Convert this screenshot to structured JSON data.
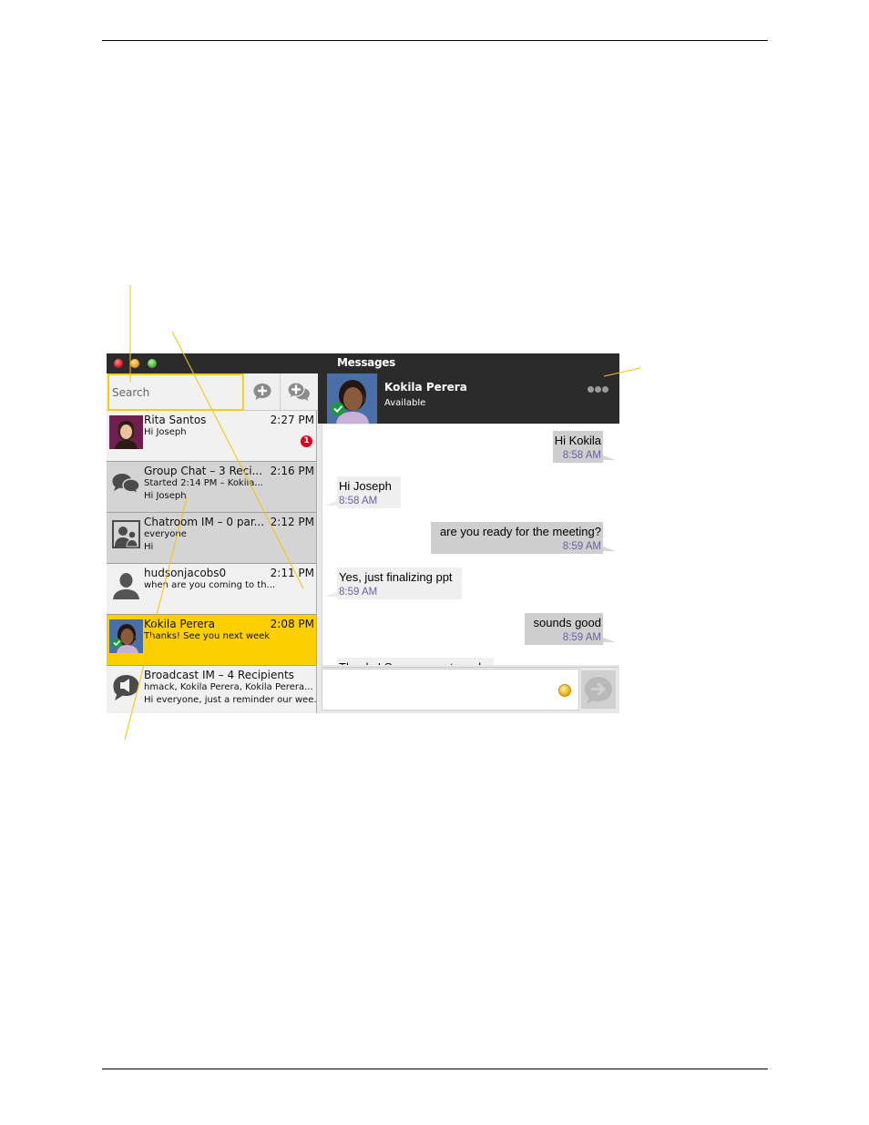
{
  "window": {
    "title": "Messages"
  },
  "search": {
    "placeholder": "Search"
  },
  "toolbar": {
    "new_im_icon": "plus-bubble-icon",
    "new_group_icon": "plus-double-bubble-icon"
  },
  "conversations": [
    {
      "name": "Rita Santos",
      "time": "2:27 PM",
      "line1": "Hi Joseph",
      "line2": "",
      "badge": "1",
      "avatar": "photo",
      "state": "light"
    },
    {
      "name": "Group Chat – 3 Reci...",
      "time": "2:16 PM",
      "line1": "Started 2:14 PM – Kokila...",
      "line2": "Hi Joseph",
      "avatar": "group-chat-icon",
      "state": "dark"
    },
    {
      "name": "Chatroom IM – 0 par...",
      "time": "2:12 PM",
      "line1": "everyone",
      "line2": "Hi",
      "avatar": "chatroom-icon",
      "state": "dark"
    },
    {
      "name": "hudsonjacobs0",
      "time": "2:11 PM",
      "line1": "when are you coming to th...",
      "line2": "",
      "avatar": "person-icon",
      "state": "light"
    },
    {
      "name": "Kokila Perera",
      "time": "2:08 PM",
      "line1": "Thanks! See you next week",
      "line2": "",
      "avatar": "photo",
      "presence": "available",
      "state": "selected"
    },
    {
      "name": "Broadcast IM – 4 Recipients",
      "time": "",
      "line1": "hmack, Kokila Perera, Kokila Perera...",
      "line2": "Hi everyone, just a reminder our wee.",
      "avatar": "broadcast-icon",
      "state": "light"
    }
  ],
  "contact": {
    "name": "Kokila Perera",
    "status": "Available"
  },
  "messages": [
    {
      "direction": "out",
      "text": "Hi Kokila",
      "time": "8:58 AM"
    },
    {
      "direction": "in",
      "text": "Hi Joseph",
      "time": "8:58 AM"
    },
    {
      "direction": "out",
      "text": "are you ready for the meeting?",
      "time": "8:59 AM"
    },
    {
      "direction": "in",
      "text": "Yes, just finalizing ppt",
      "time": "8:59 AM"
    },
    {
      "direction": "out",
      "text": "sounds good",
      "time": "8:59 AM"
    },
    {
      "direction": "in",
      "text": "Thanks! See you next week",
      "time": ""
    }
  ],
  "composer": {
    "value": "",
    "placeholder": ""
  },
  "colors": {
    "accent": "#fcd000",
    "titlebar": "#2b2b2b",
    "badge": "#e0001a",
    "callout": "#f5c400",
    "timestamp": "#6b5fa0"
  }
}
